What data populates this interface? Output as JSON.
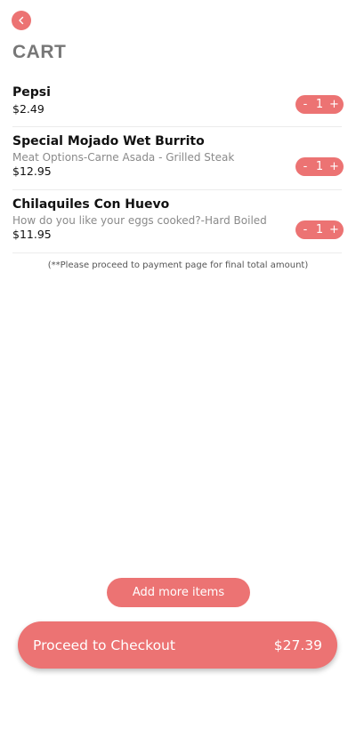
{
  "header": {
    "back_icon": "chevron-left-icon",
    "title": "CART"
  },
  "cart": {
    "items": [
      {
        "name": "Pepsi",
        "option": "",
        "price": "$2.49",
        "quantity": "1"
      },
      {
        "name": "Special Mojado Wet Burrito",
        "option": "Meat Options-Carne Asada - Grilled Steak",
        "price": "$12.95",
        "quantity": "1"
      },
      {
        "name": "Chilaquiles Con Huevo",
        "option": "How do you like your eggs cooked?-Hard Boiled",
        "price": "$11.95",
        "quantity": "1"
      }
    ],
    "stepper": {
      "minus": "-",
      "plus": "+"
    },
    "note": "(**Please proceed to payment page for final total amount)"
  },
  "actions": {
    "add_more_label": "Add more items",
    "checkout_label": "Proceed to Checkout",
    "checkout_total": "$27.39"
  },
  "colors": {
    "accent": "#ec7373",
    "title": "#777777",
    "option_text": "#8a8a8a"
  }
}
